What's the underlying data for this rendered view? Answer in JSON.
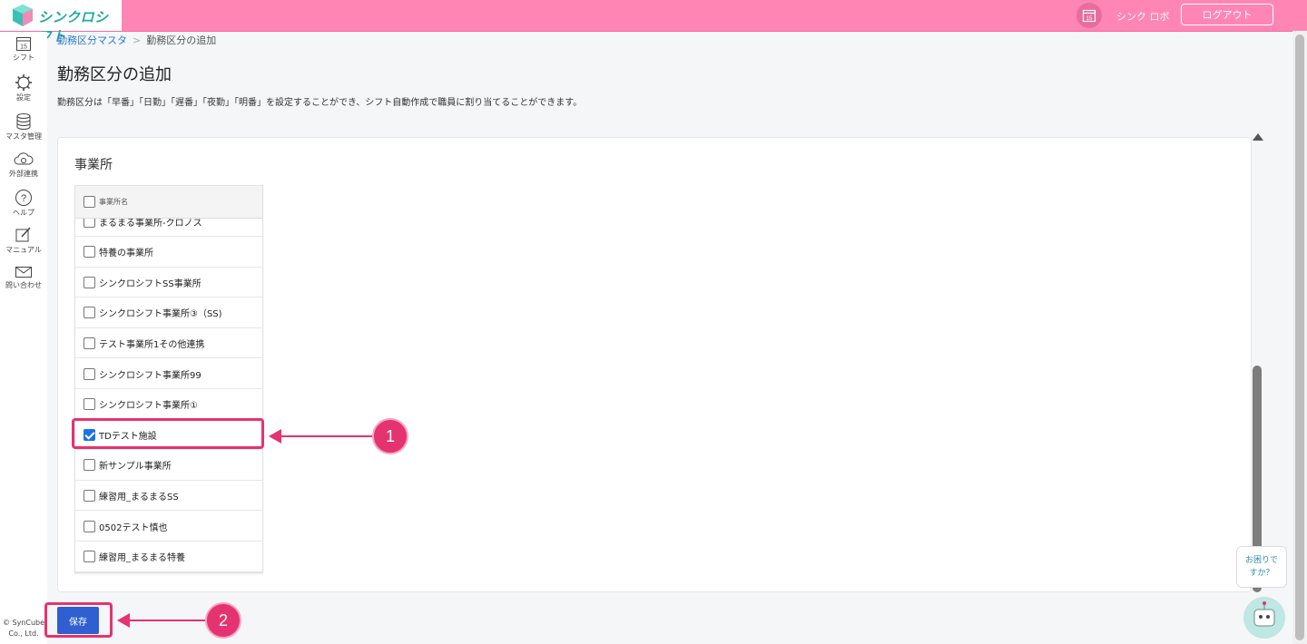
{
  "header": {
    "logo_text": "シンクロシフト",
    "calendar_day": "15",
    "user_name": "シンク ロボ",
    "logout_label": "ログアウト"
  },
  "sidebar": {
    "items": [
      {
        "label": "シフト",
        "icon": "calendar-icon",
        "day": "15"
      },
      {
        "label": "設定",
        "icon": "gear-icon"
      },
      {
        "label": "マスタ管理",
        "icon": "database-icon"
      },
      {
        "label": "外部連携",
        "icon": "cloud-sync-icon"
      },
      {
        "label": "ヘルプ",
        "icon": "question-icon"
      },
      {
        "label": "マニュアル",
        "icon": "edit-icon"
      },
      {
        "label": "問い合わせ",
        "icon": "mail-icon"
      }
    ],
    "copyright_line1": "© SynCube",
    "copyright_line2": "Co., Ltd."
  },
  "breadcrumb": {
    "parent": "勤務区分マスタ",
    "separator": ">",
    "current": "勤務区分の追加"
  },
  "page": {
    "title": "勤務区分の追加",
    "description": "勤務区分は「早番」「日勤」「遅番」「夜勤」「明番」を設定することができ、シフト自動作成で職員に割り当てることができます。"
  },
  "section": {
    "title": "事業所",
    "column_header": "事業所名",
    "rows": [
      {
        "label": "まるまる事業所-クロノス",
        "checked": false
      },
      {
        "label": "特養の事業所",
        "checked": false
      },
      {
        "label": "シンクロシフトSS事業所",
        "checked": false
      },
      {
        "label": "シンクロシフト事業所③（SS)",
        "checked": false
      },
      {
        "label": "テスト事業所1その他連携",
        "checked": false
      },
      {
        "label": "シンクロシフト事業所99",
        "checked": false
      },
      {
        "label": "シンクロシフト事業所①",
        "checked": false
      },
      {
        "label": "TDテスト施設",
        "checked": true
      },
      {
        "label": "新サンプル事業所",
        "checked": false
      },
      {
        "label": "練習用_まるまるSS",
        "checked": false
      },
      {
        "label": "0502テスト慎也",
        "checked": false
      },
      {
        "label": "練習用_まるまる特養",
        "checked": false
      }
    ]
  },
  "annotations": {
    "badge1": "1",
    "badge2": "2",
    "accent_color": "#e5336f"
  },
  "save_label": "保存",
  "help": {
    "line1": "お困りで",
    "line2": "すか？"
  }
}
